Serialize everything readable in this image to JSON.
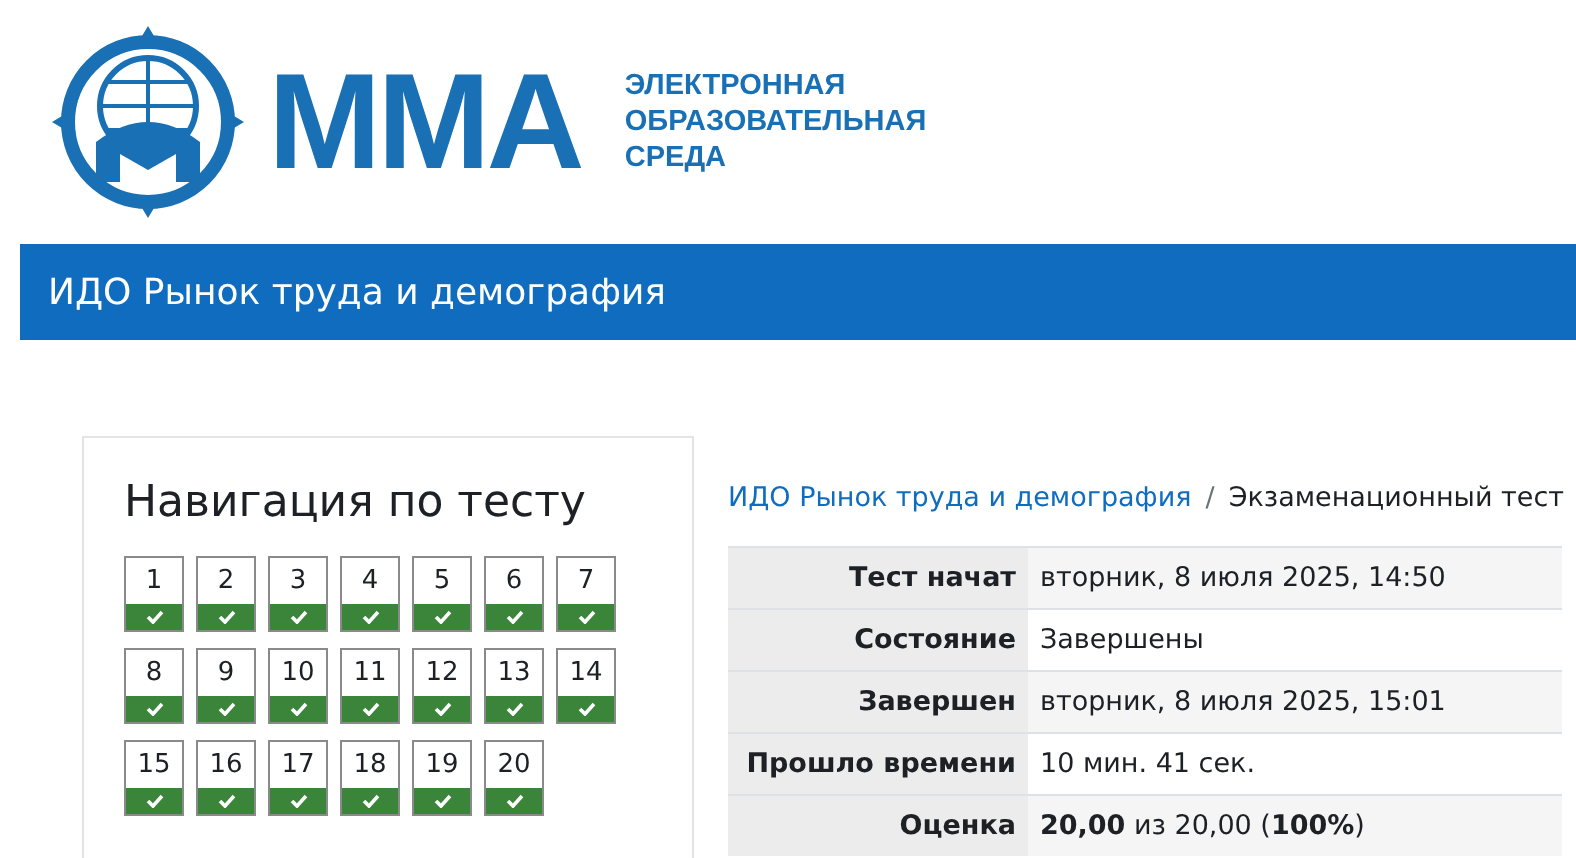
{
  "logo": {
    "wordmark": "ММА",
    "tagline": [
      "ЭЛЕКТРОННАЯ",
      "ОБРАЗОВАТЕЛЬНАЯ",
      "СРЕДА"
    ]
  },
  "header": {
    "title": "ИДО Рынок труда и демография"
  },
  "quiz_navigation": {
    "title": "Навигация по тесту",
    "questions": [
      {
        "label": "1",
        "answered": true
      },
      {
        "label": "2",
        "answered": true
      },
      {
        "label": "3",
        "answered": true
      },
      {
        "label": "4",
        "answered": true
      },
      {
        "label": "5",
        "answered": true
      },
      {
        "label": "6",
        "answered": true
      },
      {
        "label": "7",
        "answered": true
      },
      {
        "label": "8",
        "answered": true
      },
      {
        "label": "9",
        "answered": true
      },
      {
        "label": "10",
        "answered": true
      },
      {
        "label": "11",
        "answered": true
      },
      {
        "label": "12",
        "answered": true
      },
      {
        "label": "13",
        "answered": true
      },
      {
        "label": "14",
        "answered": true
      },
      {
        "label": "15",
        "answered": true
      },
      {
        "label": "16",
        "answered": true
      },
      {
        "label": "17",
        "answered": true
      },
      {
        "label": "18",
        "answered": true
      },
      {
        "label": "19",
        "answered": true
      },
      {
        "label": "20",
        "answered": true
      }
    ]
  },
  "breadcrumb": {
    "separator": "/",
    "items": [
      "ИДО Рынок труда и демография",
      "Экзаменационный тест"
    ]
  },
  "summary": [
    {
      "label": "Тест начат",
      "value": "вторник, 8 июля 2025, 14:50"
    },
    {
      "label": "Состояние",
      "value": "Завершены"
    },
    {
      "label": "Завершен",
      "value": "вторник, 8 июля 2025, 15:01"
    },
    {
      "label": "Прошло времени",
      "value": "10 мин. 41 сек."
    },
    {
      "label": "Оценка",
      "value": "**20,00** из 20,00 (**100%**)"
    }
  ]
}
